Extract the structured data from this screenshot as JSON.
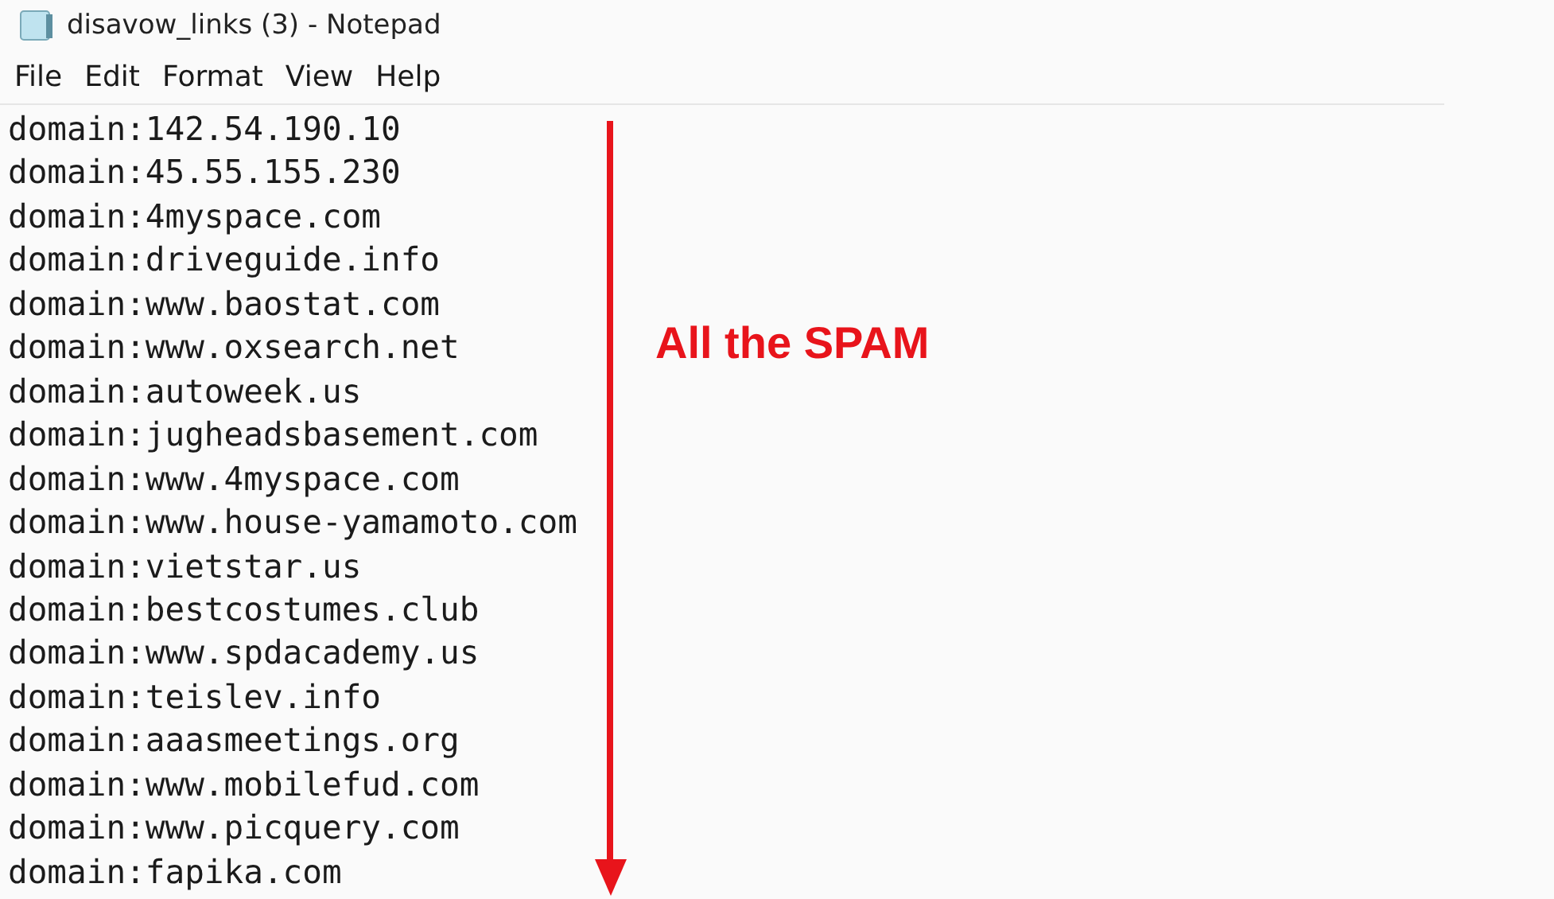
{
  "window": {
    "title": "disavow_links (3) - Notepad"
  },
  "menu": [
    "File",
    "Edit",
    "Format",
    "View",
    "Help"
  ],
  "lines": [
    "domain:142.54.190.10",
    "domain:45.55.155.230",
    "domain:4myspace.com",
    "domain:driveguide.info",
    "domain:www.baostat.com",
    "domain:www.oxsearch.net",
    "domain:autoweek.us",
    "domain:jugheadsbasement.com",
    "domain:www.4myspace.com",
    "domain:www.house-yamamoto.com",
    "domain:vietstar.us",
    "domain:bestcostumes.club",
    "domain:www.spdacademy.us",
    "domain:teislev.info",
    "domain:aaasmeetings.org",
    "domain:www.mobilefud.com",
    "domain:www.picquery.com",
    "domain:fapika.com"
  ],
  "annotation": {
    "label": "All the SPAM"
  }
}
